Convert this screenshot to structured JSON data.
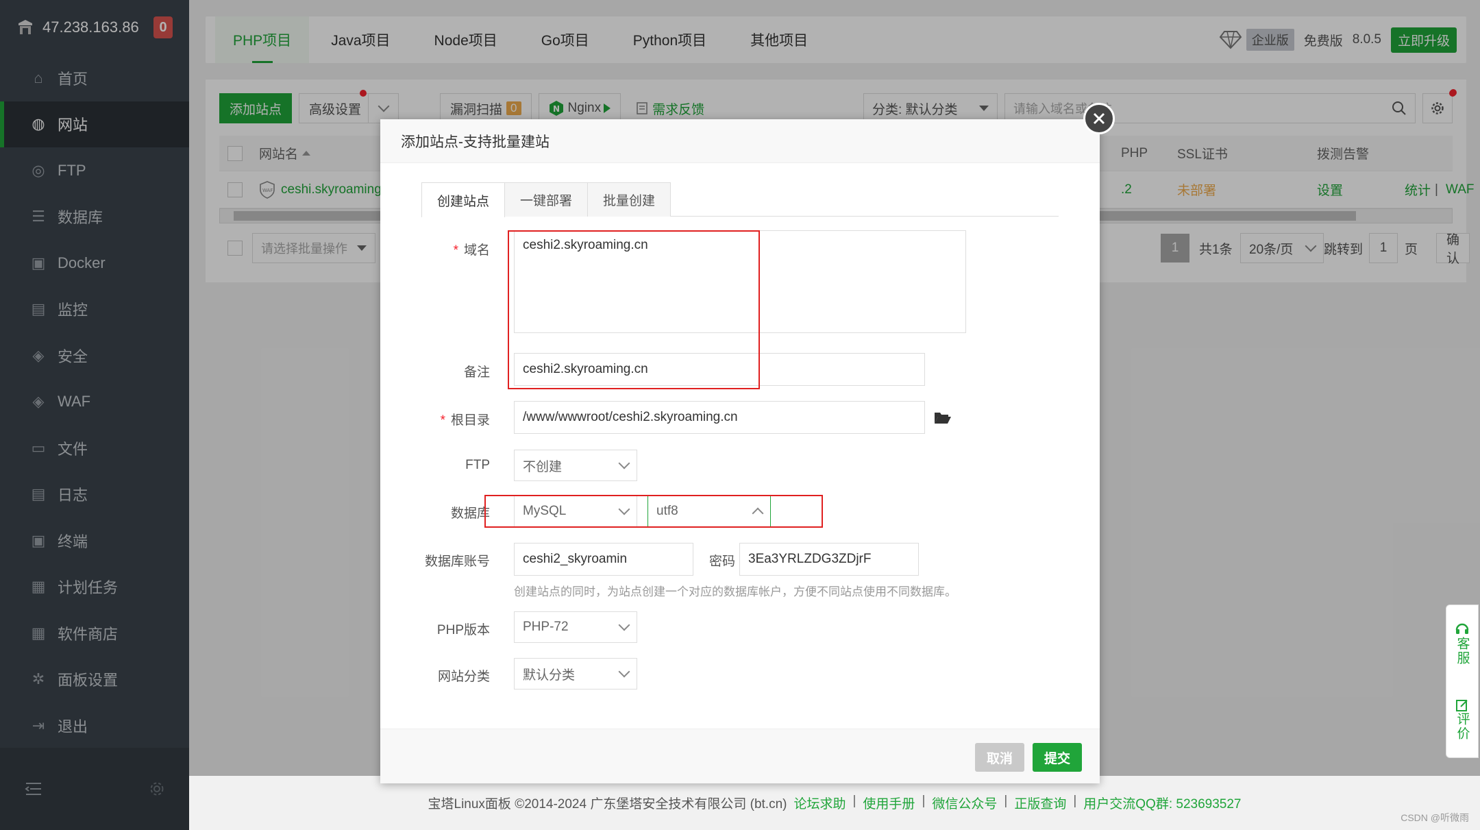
{
  "sidebar": {
    "ip": "47.238.163.86",
    "badge": "0",
    "items": [
      {
        "label": "首页",
        "icon": "home-icon"
      },
      {
        "label": "网站",
        "icon": "globe-icon"
      },
      {
        "label": "FTP",
        "icon": "ftp-icon"
      },
      {
        "label": "数据库",
        "icon": "database-icon"
      },
      {
        "label": "Docker",
        "icon": "docker-icon"
      },
      {
        "label": "监控",
        "icon": "monitor-icon"
      },
      {
        "label": "安全",
        "icon": "shield-icon"
      },
      {
        "label": "WAF",
        "icon": "waf-icon"
      },
      {
        "label": "文件",
        "icon": "folder-icon"
      },
      {
        "label": "日志",
        "icon": "log-icon"
      },
      {
        "label": "终端",
        "icon": "terminal-icon"
      },
      {
        "label": "计划任务",
        "icon": "calendar-icon"
      },
      {
        "label": "软件商店",
        "icon": "apps-icon"
      },
      {
        "label": "面板设置",
        "icon": "gear-icon"
      },
      {
        "label": "退出",
        "icon": "logout-icon"
      }
    ]
  },
  "project_tabs": [
    "PHP项目",
    "Java项目",
    "Node项目",
    "Go项目",
    "Python项目",
    "其他项目"
  ],
  "topbar": {
    "edition_tag": "企业版",
    "free_label": "免费版",
    "version": "8.0.5",
    "upgrade": "立即升级"
  },
  "toolbar": {
    "add_site": "添加站点",
    "advanced": "高级设置",
    "scan": "漏洞扫描",
    "scan_count": "0",
    "nginx": "Nginx",
    "feedback": "需求反馈",
    "category": "分类: 默认分类",
    "search_placeholder": "请输入域名或备注"
  },
  "table": {
    "headers": {
      "name": "网站名",
      "php": "PHP",
      "ssl": "SSL证书",
      "alert": "拨测告警"
    },
    "row": {
      "name": "ceshi.skyroaming",
      "php": ".2",
      "ssl": "未部署",
      "alert": "设置",
      "stats": "统计",
      "waf": "WAF"
    }
  },
  "pager": {
    "batch_placeholder": "请选择批量操作",
    "page": "1",
    "total": "共1条",
    "per_page": "20条/页",
    "jump_label": "跳转到",
    "jump_value": "1",
    "page_unit": "页",
    "confirm": "确认"
  },
  "dialog": {
    "title": "添加站点-支持批量建站",
    "tabs": [
      "创建站点",
      "一键部署",
      "批量创建"
    ],
    "domain_label": "域名",
    "domain_value": "ceshi2.skyroaming.cn",
    "remark_label": "备注",
    "remark_value": "ceshi2.skyroaming.cn",
    "root_label": "根目录",
    "root_value": "/www/wwwroot/ceshi2.skyroaming.cn",
    "ftp_label": "FTP",
    "ftp_value": "不创建",
    "db_label": "数据库",
    "db_type": "MySQL",
    "db_charset": "utf8",
    "db_account_label": "数据库账号",
    "db_account_value": "ceshi2_skyroamin",
    "password_label": "密码",
    "password_value": "3Ea3YRLZDG3ZDjrF",
    "db_hint": "创建站点的同时，为站点创建一个对应的数据库帐户，方便不同站点使用不同数据库。",
    "php_label": "PHP版本",
    "php_value": "PHP-72",
    "category_label": "网站分类",
    "category_value": "默认分类",
    "cancel": "取消",
    "submit": "提交"
  },
  "side_float": {
    "service": "客服",
    "review": "评价"
  },
  "footer": {
    "copyright": "宝塔Linux面板 ©2014-2024 广东堡塔安全技术有限公司 (bt.cn)",
    "links": [
      "论坛求助",
      "使用手册",
      "微信公众号",
      "正版查询"
    ],
    "qq": "用户交流QQ群: 523693527",
    "watermark": "CSDN @听微雨"
  },
  "colors": {
    "accent": "#20a53a",
    "sidebar": "#3c444d",
    "highlight": "#e02020"
  }
}
